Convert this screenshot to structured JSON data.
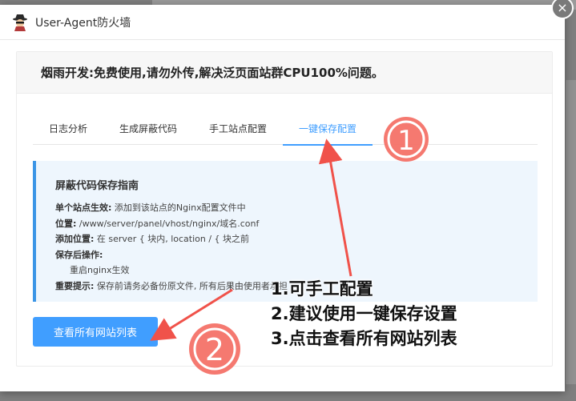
{
  "window": {
    "title": "User-Agent防火墙",
    "close_glyph": "×"
  },
  "notice": {
    "text": "烟雨开发:免费使用,请勿外传,解决泛页面站群CPU100%问题。"
  },
  "tabs": [
    {
      "label": "日志分析"
    },
    {
      "label": "生成屏蔽代码"
    },
    {
      "label": "手工站点配置"
    },
    {
      "label": "一键保存配置"
    }
  ],
  "guide": {
    "title": "屏蔽代码保存指南",
    "items": [
      {
        "label": "单个站点生效:",
        "text": "添加到该站点的Nginx配置文件中"
      },
      {
        "label": "位置:",
        "text": "/www/server/panel/vhost/nginx/域名.conf"
      },
      {
        "label": "添加位置:",
        "text": "在 server { 块内, location / { 块之前"
      },
      {
        "label": "保存后操作:",
        "text": ""
      },
      {
        "label": "",
        "text": "重启nginx生效"
      },
      {
        "label": "重要提示:",
        "text": "保存前请务必备份原文件, 所有后果由使用者承担"
      }
    ]
  },
  "buttons": {
    "view_sites": "查看所有网站列表"
  },
  "annotations": {
    "marker1": "1",
    "marker2": "2",
    "lines": [
      "1.可手工配置",
      "2.建议使用一键保存设置",
      "3.点击查看所有网站列表"
    ],
    "color": "#f0524a"
  },
  "colors": {
    "accent": "#409eff",
    "annotation": "#f0524a"
  }
}
